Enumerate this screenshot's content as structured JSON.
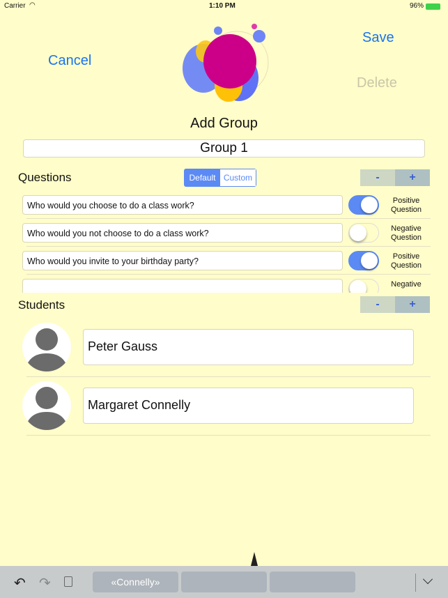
{
  "status": {
    "carrier": "Carrier",
    "time": "1:10 PM",
    "battery": "96%"
  },
  "nav": {
    "cancel": "Cancel",
    "save": "Save",
    "delete": "Delete",
    "title": "Add Group"
  },
  "group_name": "Group 1",
  "questions": {
    "heading": "Questions",
    "segments": [
      "Default",
      "Custom"
    ],
    "selected_segment": "Default",
    "minus": "-",
    "plus": "+",
    "items": [
      {
        "text": "Who would you choose to do a class work?",
        "on": true,
        "label1": "Positive",
        "label2": "Question"
      },
      {
        "text": "Who would you not choose to do a class work?",
        "on": false,
        "label1": "Negative",
        "label2": "Question"
      },
      {
        "text": "Who would you invite to your birthday party?",
        "on": true,
        "label1": "Positive",
        "label2": "Question"
      },
      {
        "text": "",
        "on": false,
        "label1": "Negative",
        "label2": ""
      }
    ]
  },
  "students": {
    "heading": "Students",
    "minus": "-",
    "plus": "+",
    "items": [
      {
        "name": "Peter Gauss"
      },
      {
        "name": "Margaret Connelly"
      }
    ]
  },
  "keyboard": {
    "suggestions": [
      "«Connelly»",
      "",
      ""
    ]
  },
  "colors": {
    "accent": "#1a73f0",
    "toggle_on": "#5b8af5",
    "background": "#fffdc9"
  }
}
